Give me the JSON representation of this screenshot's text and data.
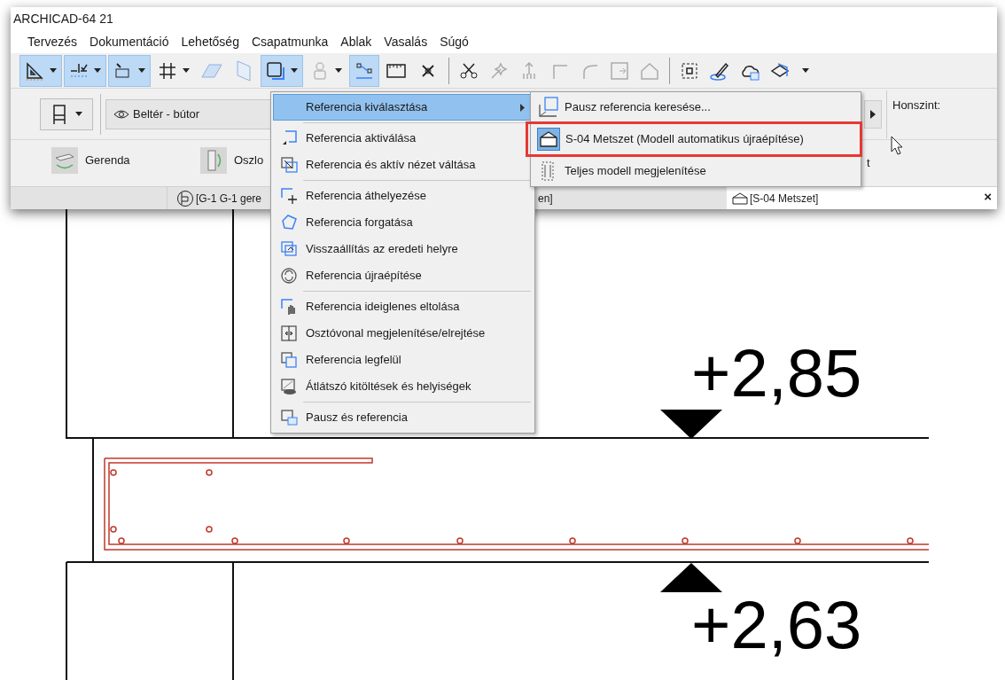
{
  "window": {
    "title": "ARCHICAD-64 21"
  },
  "menu_bar": [
    "Tervezés",
    "Dokumentáció",
    "Lehetőség",
    "Csapatmunka",
    "Ablak",
    "Vasalás",
    "Súgó"
  ],
  "toolbar": [
    {
      "on": true
    },
    {
      "on": true
    },
    {
      "on": true
    },
    {
      "on": false
    },
    {
      "on": false
    },
    {
      "on": false
    },
    {
      "on": true
    },
    {
      "on": false
    },
    {
      "on": true
    },
    {
      "on": false
    },
    {
      "on": false
    }
  ],
  "info_box": {
    "layer": "Beltér - bútor",
    "story_label": "Honszint:"
  },
  "tools": [
    {
      "label": "Gerenda"
    },
    {
      "label": "Oszlo"
    }
  ],
  "info_fragment": "t",
  "tabs": [
    {
      "texts": [
        "[G-1 G-1 gere",
        "en]"
      ],
      "selected": false
    },
    {
      "texts": [
        "[S-04 Metszet]"
      ],
      "selected": true
    }
  ],
  "tab_close": "×",
  "context_menu": {
    "items": [
      {
        "kind": "item",
        "label": "Referencia kiválasztása",
        "highlighted": true,
        "submenu": true
      },
      {
        "kind": "separator"
      },
      {
        "kind": "item",
        "label": "Referencia aktiválása",
        "highlighted": false,
        "submenu": false
      },
      {
        "kind": "item",
        "label": "Referencia és aktív nézet váltása",
        "highlighted": false,
        "submenu": false
      },
      {
        "kind": "separator"
      },
      {
        "kind": "item",
        "label": "Referencia áthelyezése",
        "highlighted": false,
        "submenu": false
      },
      {
        "kind": "item",
        "label": "Referencia forgatása",
        "highlighted": false,
        "submenu": false
      },
      {
        "kind": "item",
        "label": "Visszaállítás az eredeti helyre",
        "highlighted": false,
        "submenu": false
      },
      {
        "kind": "item",
        "label": "Referencia újraépítése",
        "highlighted": false,
        "submenu": false
      },
      {
        "kind": "separator"
      },
      {
        "kind": "item",
        "label": "Referencia ideiglenes eltolása",
        "highlighted": false,
        "submenu": false
      },
      {
        "kind": "item",
        "label": "Osztóvonal megjelenítése/elrejtése",
        "highlighted": false,
        "submenu": false
      },
      {
        "kind": "item",
        "label": "Referencia legfelül",
        "highlighted": false,
        "submenu": false
      },
      {
        "kind": "item",
        "label": "Átlátszó kitöltések és helyiségek",
        "highlighted": false,
        "submenu": false
      },
      {
        "kind": "separator"
      },
      {
        "kind": "item",
        "label": "Pausz és referencia",
        "highlighted": false,
        "submenu": false
      }
    ]
  },
  "submenu": {
    "items": [
      {
        "label": "Pausz referencia keresése...",
        "checked": false,
        "outlined": false
      },
      {
        "label": "S-04 Metszet (Modell automatikus újraépítése)",
        "checked": true,
        "outlined": true
      },
      {
        "label": "Teljes modell megjelenítése",
        "checked": false,
        "outlined": false
      }
    ]
  },
  "canvas": {
    "levels": [
      {
        "label": "+2,85",
        "kind": "down"
      },
      {
        "label": "+2,63",
        "kind": "up"
      }
    ]
  }
}
